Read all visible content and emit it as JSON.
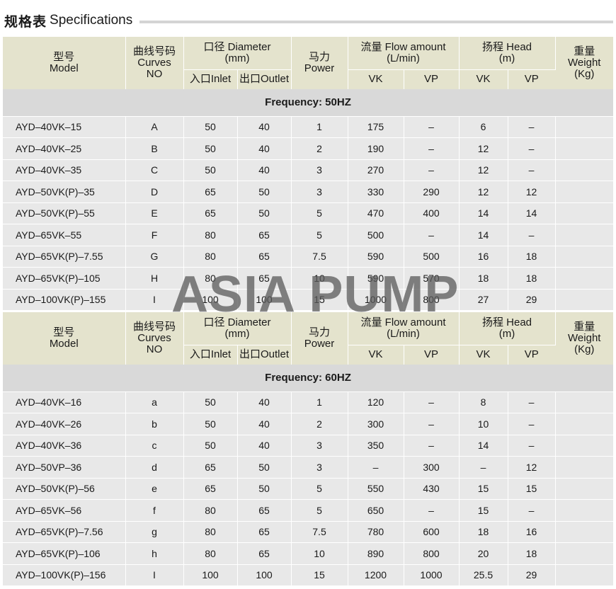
{
  "title": {
    "cn": "规格表",
    "en": "Specifications"
  },
  "header": {
    "model_cn": "型号",
    "model_en": "Model",
    "curves_cn": "曲线号码",
    "curves_en1": "Curves",
    "curves_en2": "NO",
    "diameter": "口径 Diameter",
    "diameter_unit": "(mm)",
    "inlet": "入口Inlet",
    "outlet": "出口Outlet",
    "power_cn": "马力",
    "power_en": "Power",
    "flow": "流量 Flow amount",
    "flow_unit": "(L/min)",
    "head": "扬程 Head",
    "head_unit": "(m)",
    "vk": "VK",
    "vp": "VP",
    "weight_cn": "重量",
    "weight_en": "Weight",
    "weight_unit": "(Kg)"
  },
  "sections": [
    {
      "frequency": "Frequency: 50HZ",
      "rows": [
        [
          "AYD–40VK–15",
          "A",
          "50",
          "40",
          "1",
          "175",
          "–",
          "6",
          "–",
          ""
        ],
        [
          "AYD–40VK–25",
          "B",
          "50",
          "40",
          "2",
          "190",
          "–",
          "12",
          "–",
          ""
        ],
        [
          "AYD–40VK–35",
          "C",
          "50",
          "40",
          "3",
          "270",
          "–",
          "12",
          "–",
          ""
        ],
        [
          "AYD–50VK(P)–35",
          "D",
          "65",
          "50",
          "3",
          "330",
          "290",
          "12",
          "12",
          ""
        ],
        [
          "AYD–50VK(P)–55",
          "E",
          "65",
          "50",
          "5",
          "470",
          "400",
          "14",
          "14",
          ""
        ],
        [
          "AYD–65VK–55",
          "F",
          "80",
          "65",
          "5",
          "500",
          "–",
          "14",
          "–",
          ""
        ],
        [
          "AYD–65VK(P)–7.55",
          "G",
          "80",
          "65",
          "7.5",
          "590",
          "500",
          "16",
          "18",
          ""
        ],
        [
          "AYD–65VK(P)–105",
          "H",
          "80",
          "65",
          "10",
          "590",
          "570",
          "18",
          "18",
          ""
        ],
        [
          "AYD–100VK(P)–155",
          "I",
          "100",
          "100",
          "15",
          "1000",
          "800",
          "27",
          "29",
          ""
        ]
      ]
    },
    {
      "frequency": "Frequency: 60HZ",
      "rows": [
        [
          "AYD–40VK–16",
          "a",
          "50",
          "40",
          "1",
          "120",
          "–",
          "8",
          "–",
          ""
        ],
        [
          "AYD–40VK–26",
          "b",
          "50",
          "40",
          "2",
          "300",
          "–",
          "10",
          "–",
          ""
        ],
        [
          "AYD–40VK–36",
          "c",
          "50",
          "40",
          "3",
          "350",
          "–",
          "14",
          "–",
          ""
        ],
        [
          "AYD–50VP–36",
          "d",
          "65",
          "50",
          "3",
          "–",
          "300",
          "–",
          "12",
          ""
        ],
        [
          "AYD–50VK(P)–56",
          "e",
          "65",
          "50",
          "5",
          "550",
          "430",
          "15",
          "15",
          ""
        ],
        [
          "AYD–65VK–56",
          "f",
          "80",
          "65",
          "5",
          "650",
          "–",
          "15",
          "–",
          ""
        ],
        [
          "AYD–65VK(P)–7.56",
          "g",
          "80",
          "65",
          "7.5",
          "780",
          "600",
          "18",
          "16",
          ""
        ],
        [
          "AYD–65VK(P)–106",
          "h",
          "80",
          "65",
          "10",
          "890",
          "800",
          "20",
          "18",
          ""
        ],
        [
          "AYD–100VK(P)–156",
          "I",
          "100",
          "100",
          "15",
          "1200",
          "1000",
          "25.5",
          "29",
          ""
        ]
      ]
    }
  ],
  "watermark": "ASIA PUMP"
}
